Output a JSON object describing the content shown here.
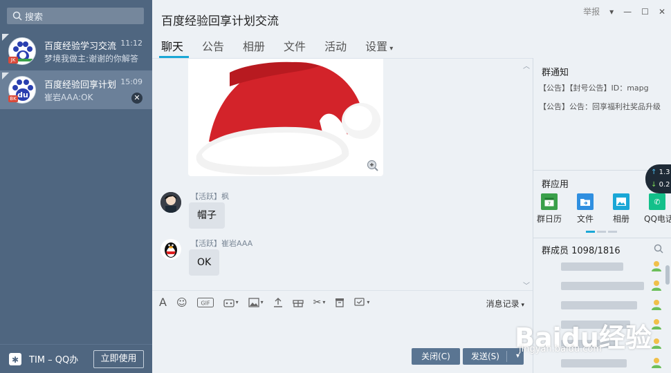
{
  "sidebar": {
    "search_placeholder": "搜索",
    "conversations": [
      {
        "name": "百度经验学习交流",
        "preview": "梦境我做主:谢谢的你解答",
        "time": "11:12",
        "badge": "JK"
      },
      {
        "name": "百度经验回享计划",
        "preview": "崔岩AAA:OK",
        "time": "15:09",
        "badge": "BK"
      }
    ],
    "footer": {
      "tim_label": "TIM – QQ办",
      "use_now": "立即使用"
    }
  },
  "header": {
    "title": "百度经验回享计划交流",
    "report": "举报",
    "tabs": [
      "聊天",
      "公告",
      "相册",
      "文件",
      "活动",
      "设置"
    ]
  },
  "chat": {
    "messages": [
      {
        "sender": "【活跃】枫",
        "text": "帽子"
      },
      {
        "sender": "【活跃】崔岩AAA",
        "text": "OK"
      }
    ]
  },
  "toolbar": {
    "history": "消息记录"
  },
  "actions": {
    "close": "关闭(C)",
    "send": "发送(S)"
  },
  "right_panel": {
    "notice_title": "群通知",
    "notices": [
      "【公告】【封号公告】ID：mapg",
      "【公告】公告：回享福利社奖品升级"
    ],
    "apps_title": "群应用",
    "apps": [
      "群日历",
      "文件",
      "相册",
      "QQ电话"
    ],
    "members_title": "群成员 1098/1816"
  },
  "net_widget": {
    "up": "1.3",
    "down": "0.2"
  },
  "watermark": {
    "logo": "Baidu经验",
    "url": "jingyan.baidu.com"
  },
  "colors": {
    "sidebar": "#4f6680",
    "accent": "#1aa7d6",
    "hat_red": "#d3232a"
  }
}
